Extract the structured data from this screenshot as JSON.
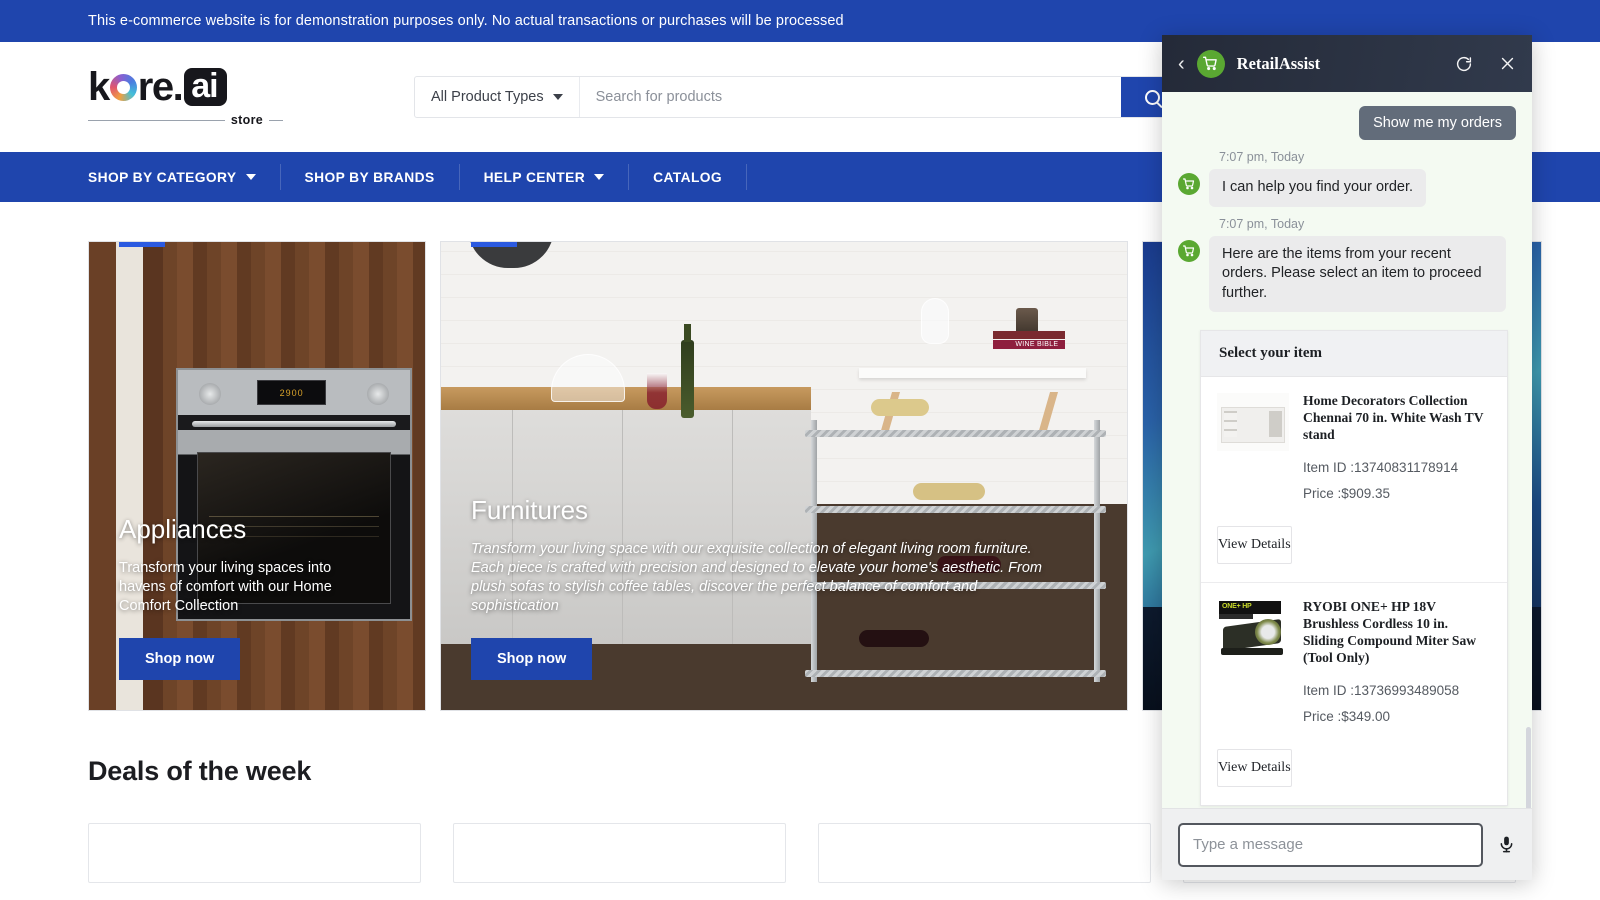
{
  "announcement": "This e-commerce website is for demonstration purposes only. No actual transactions or purchases will be processed",
  "brand": {
    "name_k": "k",
    "name_re": "re.",
    "name_ai": "ai",
    "store_label": "store"
  },
  "search": {
    "product_type_label": "All Product Types",
    "placeholder": "Search for products",
    "value": "",
    "button_label": "Search",
    "icon": "search-icon"
  },
  "nav": {
    "items": [
      {
        "label": "SHOP BY CATEGORY",
        "has_chevron": true
      },
      {
        "label": "SHOP BY BRANDS",
        "has_chevron": false
      },
      {
        "label": "HELP CENTER",
        "has_chevron": true
      },
      {
        "label": "CATALOG",
        "has_chevron": false
      }
    ]
  },
  "hero": {
    "cards": [
      {
        "title": "Appliances",
        "description": "Transform your living spaces into havens of comfort with our Home Comfort Collection",
        "cta": "Shop now"
      },
      {
        "title": "Furnitures",
        "description": "Transform your living space with our exquisite collection of elegant living room furniture. Each piece is crafted with precision and designed to elevate your home's aesthetic. From plush sofas to stylish coffee tables, discover the perfect balance of comfort and sophistication",
        "cta": "Shop now"
      },
      {
        "title": "",
        "description": "",
        "cta": ""
      }
    ]
  },
  "deals": {
    "title": "Deals of the week"
  },
  "chat": {
    "title": "RetailAssist",
    "back_icon": "chevron-left-icon",
    "avatar_icon": "shopping-cart-icon",
    "refresh_icon": "refresh-icon",
    "close_icon": "close-icon",
    "messages": [
      {
        "type": "user",
        "text": "Show me my orders"
      },
      {
        "type": "bot",
        "timestamp": "7:07 pm, Today",
        "text": "I can help you find your order."
      },
      {
        "type": "bot",
        "timestamp": "7:07 pm, Today",
        "text": "Here are the items from your recent orders. Please select an item to proceed further."
      }
    ],
    "select_card": {
      "header": "Select your item",
      "items": [
        {
          "name": "Home Decorators Collection Chennai 70 in. White Wash TV stand",
          "item_id": "Item ID :13740831178914",
          "price": "Price :$909.35",
          "button": "View Details"
        },
        {
          "name": "RYOBI ONE+ HP 18V Brushless Cordless 10 in. Sliding Compound Miter Saw (Tool Only)",
          "item_id": "Item ID :13736993489058",
          "price": "Price :$349.00",
          "button": "View Details"
        }
      ]
    },
    "composer": {
      "placeholder": "Type a message",
      "value": "",
      "mic_icon": "microphone-icon"
    }
  },
  "colors": {
    "brand_blue": "#1f45ad",
    "chat_header": "#2a3141",
    "bot_green": "#5aa832",
    "user_bubble": "#626c7a",
    "chat_bg": "#f4faf2"
  }
}
